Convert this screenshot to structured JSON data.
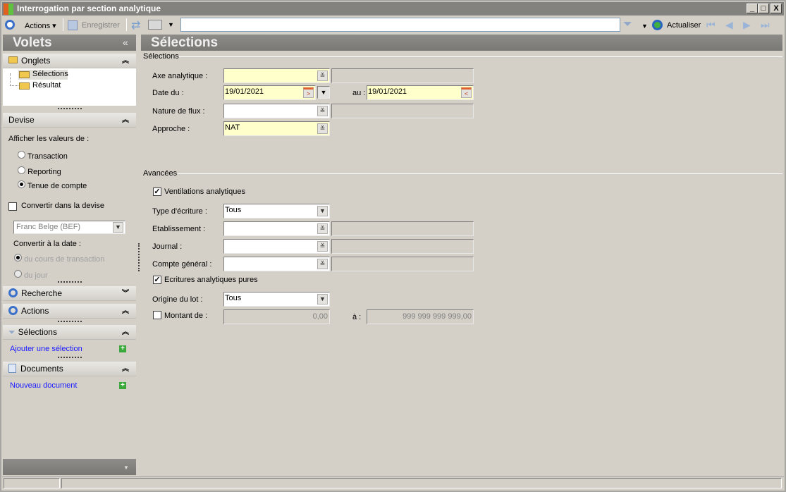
{
  "window": {
    "title": "Interrogation par section analytique",
    "minimize": "_",
    "maximize": "□",
    "close": "X"
  },
  "toolbar": {
    "actions": "Actions",
    "save": "Enregistrer",
    "search_value": "",
    "refresh": "Actualiser"
  },
  "left": {
    "title": "Volets",
    "collapse": "«",
    "onglets": {
      "title": "Onglets",
      "items": [
        "Sélections",
        "Résultat"
      ]
    },
    "devise": {
      "title": "Devise",
      "show_label": "Afficher les valeurs de :",
      "options": [
        "Transaction",
        "Reporting",
        "Tenue de compte"
      ],
      "selected": "Tenue de compte",
      "convert_label": "Convertir dans la devise",
      "convert_checked": false,
      "currency": "Franc Belge (BEF)",
      "date_label": "Convertir à la date :",
      "date_options": [
        "du cours de transaction",
        "du jour"
      ]
    },
    "recherche": {
      "title": "Recherche"
    },
    "actions": {
      "title": "Actions"
    },
    "selections": {
      "title": "Sélections",
      "link": "Ajouter une sélection"
    },
    "documents": {
      "title": "Documents",
      "link": "Nouveau document"
    }
  },
  "main": {
    "title": "Sélections",
    "group1": "Sélections",
    "axe": {
      "label": "Axe analytique :",
      "value": ""
    },
    "date": {
      "label": "Date du :",
      "from": "19/01/2021",
      "to_label": "au :",
      "to": "19/01/2021"
    },
    "nature": {
      "label": "Nature de flux :",
      "value": ""
    },
    "approche": {
      "label": "Approche :",
      "value": "NAT"
    },
    "group2": "Avancées",
    "ventilations": {
      "label": "Ventilations analytiques",
      "checked": true
    },
    "type": {
      "label": "Type d'écriture :",
      "value": "Tous"
    },
    "etab": {
      "label": "Etablissement :",
      "value": ""
    },
    "journal": {
      "label": "Journal :",
      "value": ""
    },
    "compte": {
      "label": "Compte général :",
      "value": ""
    },
    "ecritures": {
      "label": "Ecritures analytiques pures",
      "checked": true
    },
    "origine": {
      "label": "Origine du lot :",
      "value": "Tous"
    },
    "montant": {
      "label": "Montant de :",
      "checked": false,
      "from": "0,00",
      "to_label": "à :",
      "to": "999 999 999 999,00"
    }
  }
}
